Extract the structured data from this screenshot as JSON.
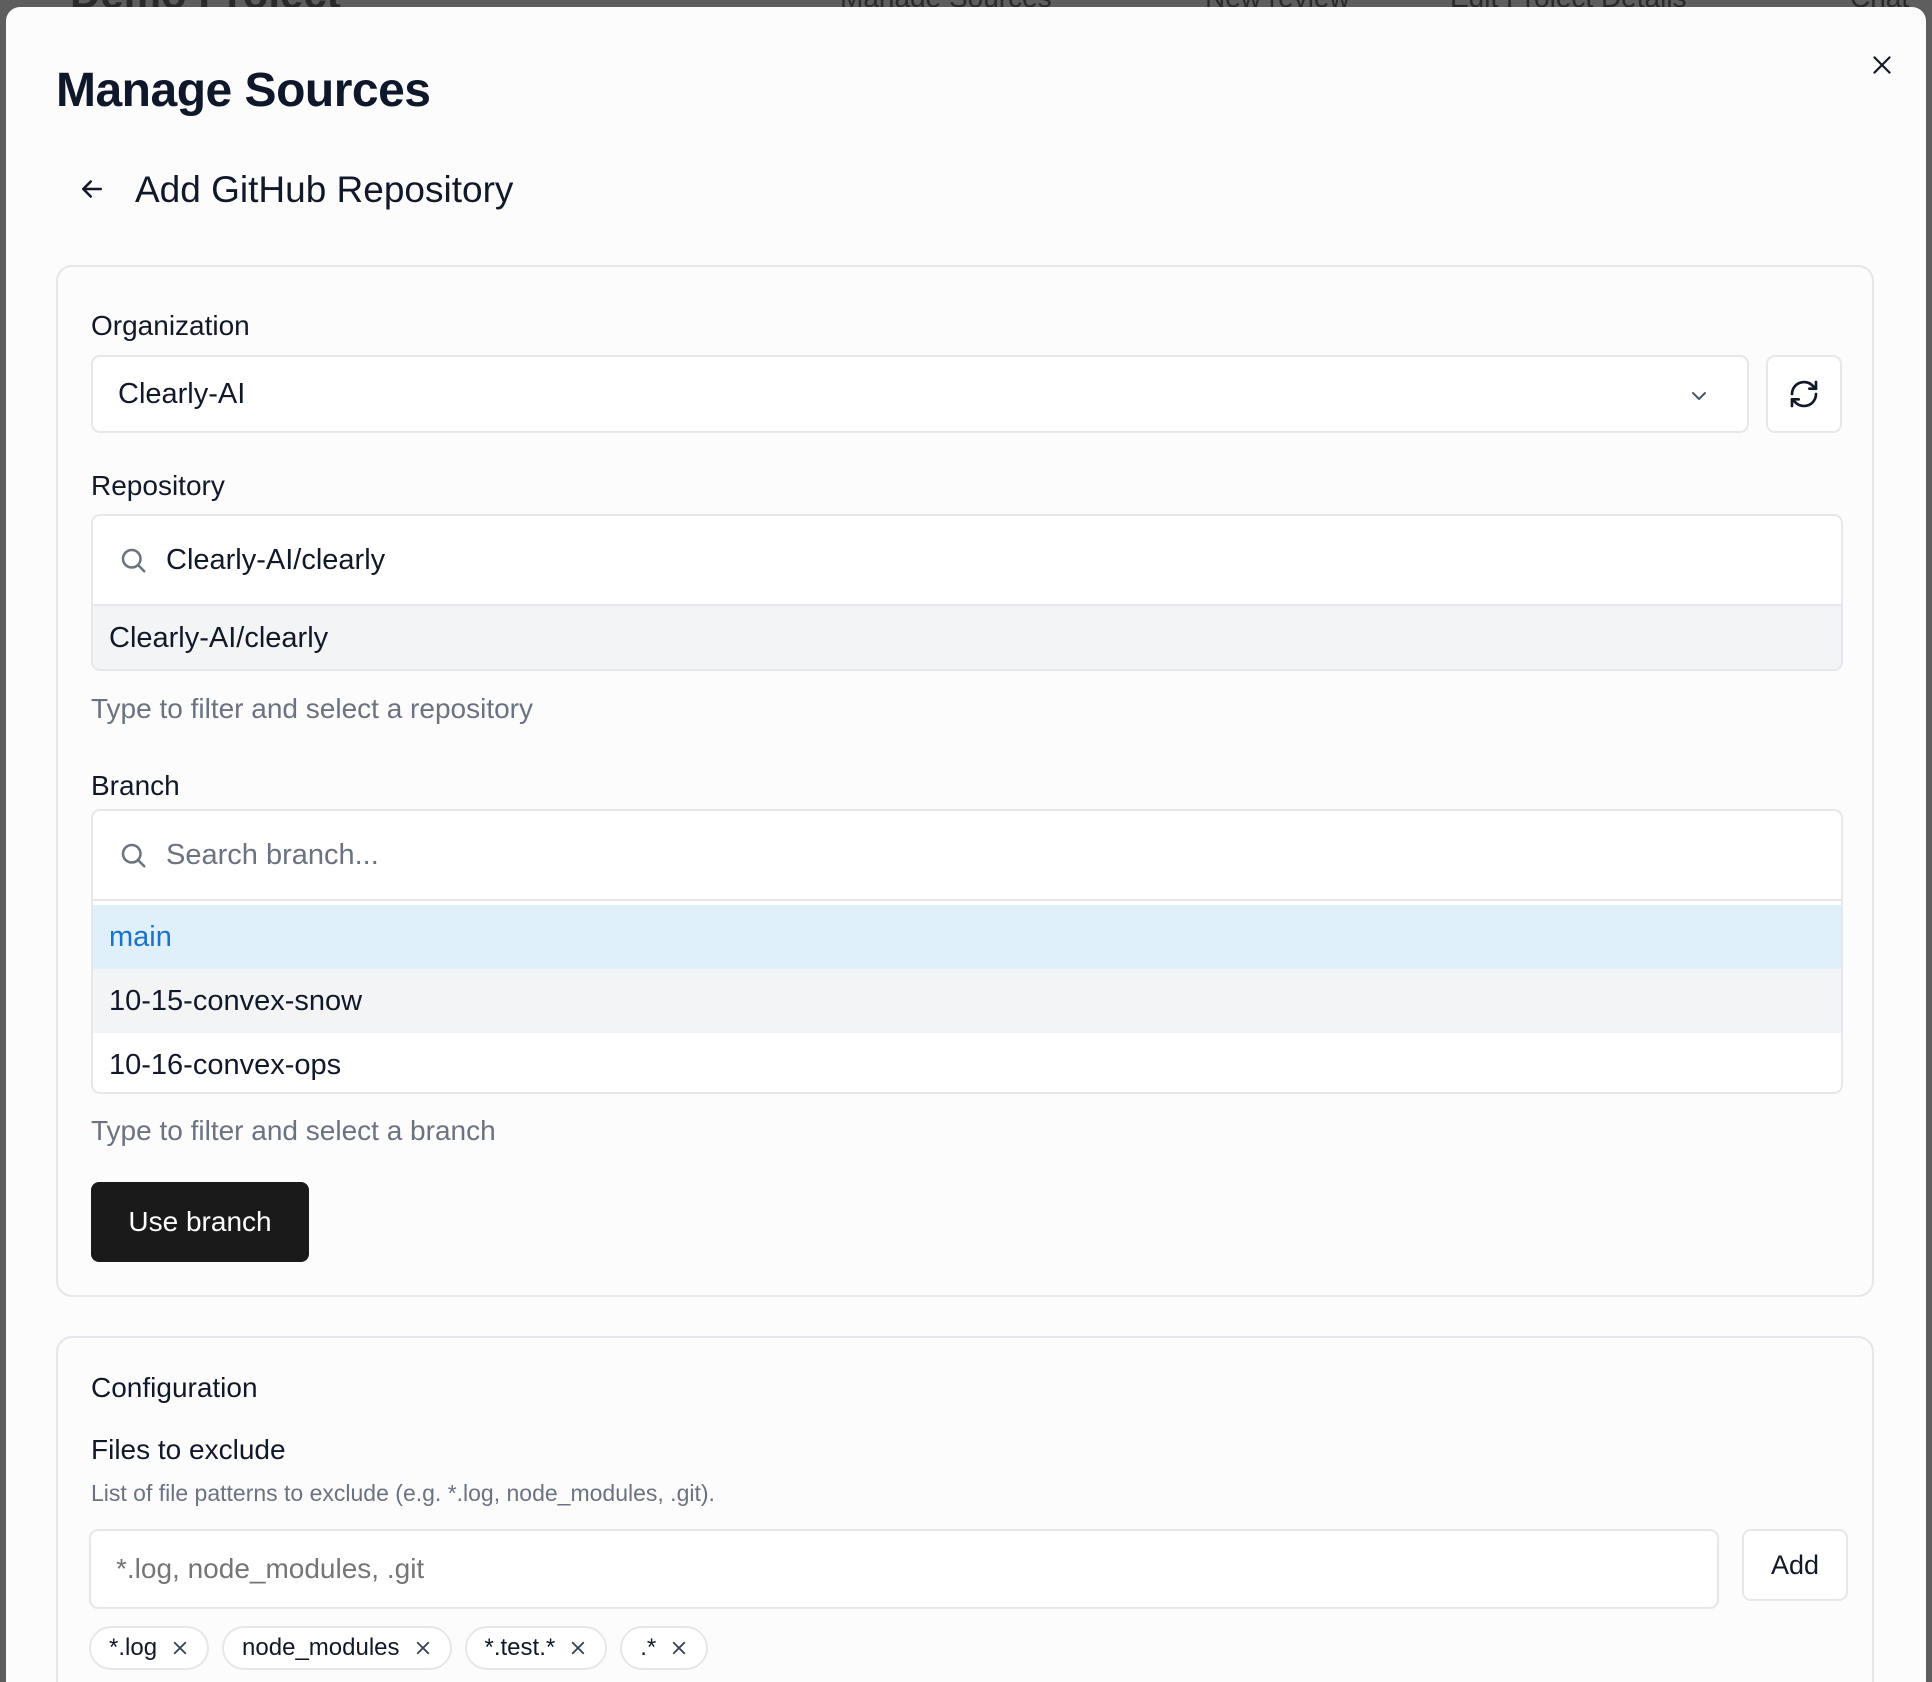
{
  "background": {
    "items": [
      "Demo Project",
      "Manage Sources",
      "New review",
      "Edit Project Details",
      "Chat"
    ]
  },
  "modal": {
    "title": "Manage Sources",
    "subtitle": "Add GitHub Repository"
  },
  "organization": {
    "label": "Organization",
    "value": "Clearly-AI"
  },
  "repository": {
    "label": "Repository",
    "value": "Clearly-AI/clearly",
    "options": [
      "Clearly-AI/clearly"
    ],
    "helper": "Type to filter and select a repository"
  },
  "branch": {
    "label": "Branch",
    "placeholder": "Search branch...",
    "options": [
      "main",
      "10-15-convex-snow",
      "10-16-convex-ops"
    ],
    "selected": "main",
    "helper": "Type to filter and select a branch",
    "button_label": "Use branch"
  },
  "configuration": {
    "heading": "Configuration",
    "exclude_label": "Files to exclude",
    "exclude_description": "List of file patterns to exclude (e.g. *.log, node_modules, .git).",
    "exclude_placeholder": "*.log, node_modules, .git",
    "add_label": "Add",
    "tags": [
      "*.log",
      "node_modules",
      "*.test.*",
      ".*"
    ]
  },
  "colors": {
    "primary_button": "#1a1a1a",
    "selected_option_bg": "#e0f0fb",
    "selected_option_text": "#1a73c8"
  }
}
